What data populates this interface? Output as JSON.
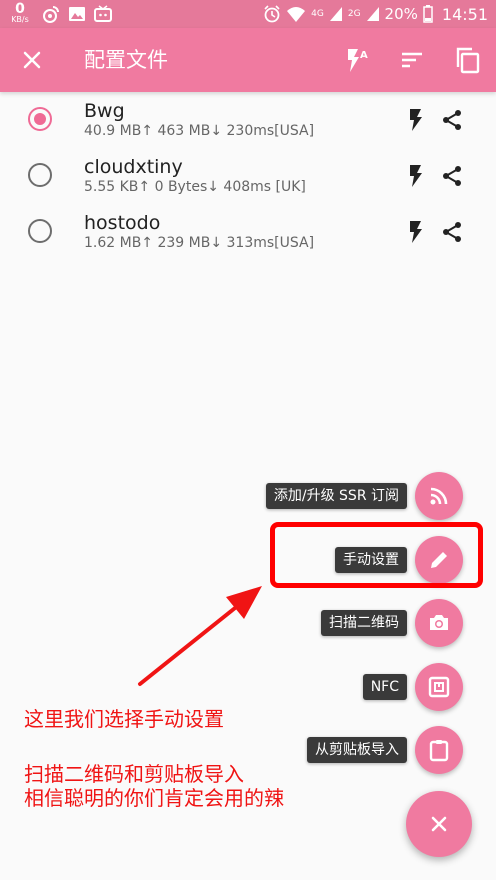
{
  "statusbar": {
    "speed_value": "0",
    "speed_unit": "KB/s",
    "network_4g": "4G",
    "network_2g": "2G",
    "battery": "20%",
    "time": "14:51"
  },
  "appbar": {
    "title": "配置文件",
    "icons": [
      "close-icon",
      "flash-auto-icon",
      "sort-icon",
      "copy-icon"
    ]
  },
  "profiles": [
    {
      "name": "Bwg",
      "stats": "40.9 MB↑ 463 MB↓ 230ms[USA]",
      "selected": true
    },
    {
      "name": "cloudxtiny",
      "stats": "5.55 KB↑ 0 Bytes↓ 408ms [UK]",
      "selected": false
    },
    {
      "name": "hostodo",
      "stats": "1.62 MB↑ 239 MB↓ 313ms[USA]",
      "selected": false
    }
  ],
  "fab_menu": {
    "subscribe_label": "添加/升级 SSR 订阅",
    "manual_label": "手动设置",
    "scan_label": "扫描二维码",
    "nfc_label": "NFC",
    "clipboard_label": "从剪贴板导入",
    "close_icon": "close-icon"
  },
  "annotation": {
    "line1": "这里我们选择手动设置",
    "line2": "扫描二维码和剪贴板导入",
    "line3": "相信聪明的你们肯定会用的辣",
    "color": "#f01414"
  },
  "colors": {
    "primary": "#f07aa0",
    "statusbar": "#e5799a",
    "accent": "#ef6a95",
    "highlight": "#ff0000"
  }
}
